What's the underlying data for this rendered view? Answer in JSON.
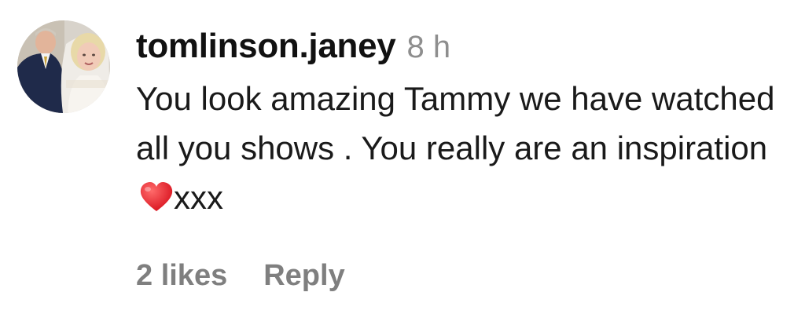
{
  "comment": {
    "username": "tomlinson.janey",
    "timestamp": "8 h",
    "text_before_emoji": "You look amazing Tammy we have watched all you shows . You really are an inspiration ",
    "text_after_emoji": "xxx",
    "emoji": "red-heart-icon",
    "likes": "2 likes",
    "reply_label": "Reply",
    "avatar": "wedding-photo-avatar"
  },
  "colors": {
    "username": "#111111",
    "timestamp": "#8e8e8e",
    "text": "#1a1a1a",
    "actions": "#7f7f7f",
    "heart": "#e0232e"
  }
}
